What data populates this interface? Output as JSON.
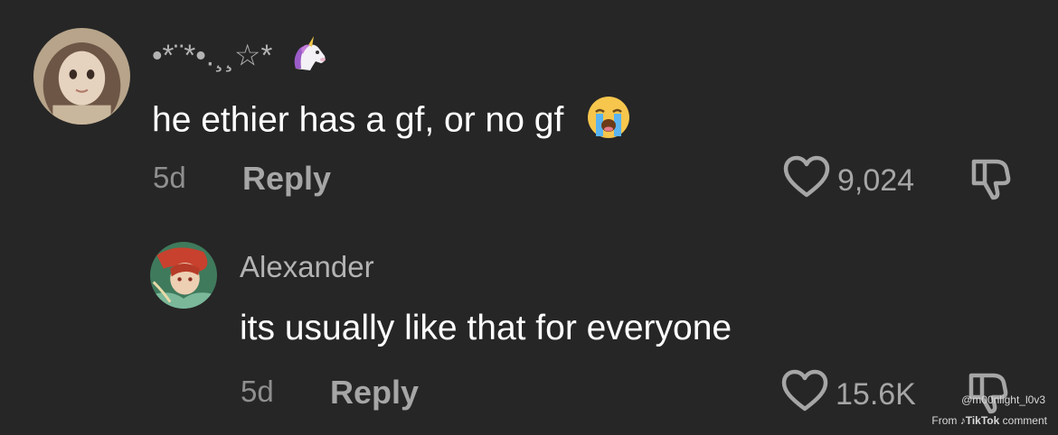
{
  "comments": [
    {
      "username": "•*¨*•.¸¸☆*",
      "username_emoji": "unicorn-emoji",
      "text": "he ethier has a gf, or no gf",
      "text_emoji": "loudly-crying-face-emoji",
      "age": "5d",
      "reply_label": "Reply",
      "likes": "9,024",
      "avatar": "avatar-drawn-girl"
    },
    {
      "username": "Alexander",
      "text": "its usually like that for everyone",
      "age": "5d",
      "reply_label": "Reply",
      "likes": "15.6K",
      "avatar": "avatar-anime-character"
    }
  ],
  "watermark": {
    "handle": "@m00nlight_l0v3",
    "from": "From",
    "brand": "TikTok",
    "suffix": "comment"
  },
  "colors": {
    "background": "#262626",
    "comment_text": "#ffffff",
    "username": "#b3b3b3",
    "meta": "#8f8f8f"
  }
}
